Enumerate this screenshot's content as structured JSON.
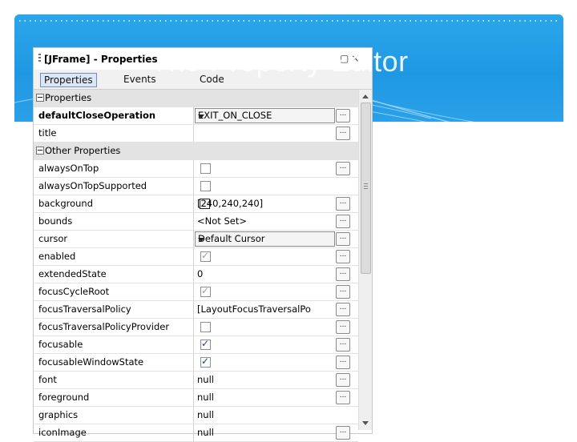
{
  "slide": {
    "title": "The Property Editor"
  },
  "window": {
    "title": "[JFrame] - Properties"
  },
  "tabs": [
    "Properties",
    "Events",
    "Code"
  ],
  "rows": [
    {
      "type": "category",
      "name": "Properties"
    },
    {
      "type": "prop",
      "name": "defaultCloseOperation",
      "bold": true,
      "value": "EXIT_ON_CLOSE",
      "editor": "combo",
      "btn": true
    },
    {
      "type": "prop",
      "name": "title",
      "value": "",
      "editor": "text",
      "btn": true
    },
    {
      "type": "category",
      "name": "Other Properties"
    },
    {
      "type": "prop",
      "name": "alwaysOnTop",
      "editor": "check",
      "checked": false,
      "btn": true
    },
    {
      "type": "prop",
      "name": "alwaysOnTopSupported",
      "editor": "check",
      "checked": false,
      "btn": false
    },
    {
      "type": "prop",
      "name": "background",
      "editor": "color",
      "value": "[240,240,240]",
      "btn": true
    },
    {
      "type": "prop",
      "name": "bounds",
      "value": "<Not Set>",
      "editor": "text",
      "btn": true
    },
    {
      "type": "prop",
      "name": "cursor",
      "value": "Default Cursor",
      "editor": "combo",
      "btn": true
    },
    {
      "type": "prop",
      "name": "enabled",
      "editor": "check",
      "checked": true,
      "disabled": true,
      "btn": true
    },
    {
      "type": "prop",
      "name": "extendedState",
      "value": "0",
      "editor": "text",
      "btn": true
    },
    {
      "type": "prop",
      "name": "focusCycleRoot",
      "editor": "check",
      "checked": true,
      "disabled": true,
      "btn": true
    },
    {
      "type": "prop",
      "name": "focusTraversalPolicy",
      "value": "[LayoutFocusTraversalPo",
      "editor": "text",
      "btn": true
    },
    {
      "type": "prop",
      "name": "focusTraversalPolicyProvider",
      "editor": "check",
      "checked": false,
      "btn": true
    },
    {
      "type": "prop",
      "name": "focusable",
      "editor": "check",
      "checked": true,
      "btn": true
    },
    {
      "type": "prop",
      "name": "focusableWindowState",
      "editor": "check",
      "checked": true,
      "btn": true
    },
    {
      "type": "prop",
      "name": "font",
      "value": "null",
      "editor": "text",
      "btn": true
    },
    {
      "type": "prop",
      "name": "foreground",
      "value": "null",
      "editor": "text",
      "btn": true
    },
    {
      "type": "prop",
      "name": "graphics",
      "value": "null",
      "editor": "text",
      "btn": false
    },
    {
      "type": "prop",
      "name": "iconImage",
      "value": "null",
      "editor": "text",
      "btn": true
    }
  ],
  "ellipsis_label": "...",
  "colors": {
    "banner": "#1f98e3",
    "category_bg": "#e3e3e3",
    "tab_active_bg": "#dbe7f6"
  }
}
